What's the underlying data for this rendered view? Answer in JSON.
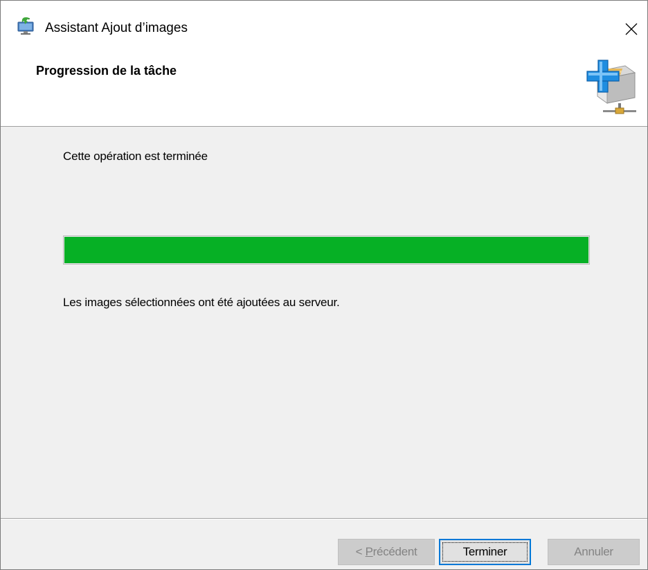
{
  "window": {
    "title": "Assistant Ajout d’images",
    "app_icon": "monitor-install-icon",
    "close_glyph": "✕",
    "close_icon": "close-icon"
  },
  "header": {
    "title": "Progression de la tâche",
    "icon": "box-add-network-icon"
  },
  "content": {
    "status_text": "Cette opération est terminée",
    "progress_percent": 100,
    "progress_color": "#06b025",
    "result_text": "Les images sélectionnées ont été ajoutées au serveur."
  },
  "buttons": {
    "previous": {
      "prefix": "< ",
      "mnemonic": "P",
      "rest": "récédent",
      "enabled": false
    },
    "finish": {
      "label": "Terminer",
      "enabled": true,
      "default": true
    },
    "cancel": {
      "label": "Annuler",
      "enabled": false
    }
  }
}
